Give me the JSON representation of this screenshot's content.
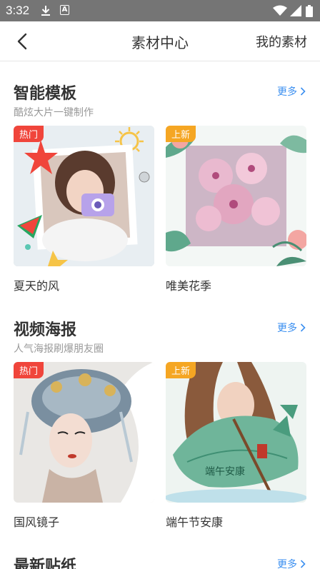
{
  "status_bar": {
    "time": "3:32",
    "a_glyph": "A"
  },
  "header": {
    "title": "素材中心",
    "right_link": "我的素材"
  },
  "sections": [
    {
      "title": "智能模板",
      "subtitle": "酷炫大片一键制作",
      "more": "更多",
      "items": [
        {
          "badge": "热门",
          "label": "夏天的风"
        },
        {
          "badge": "上新",
          "label": "唯美花季"
        }
      ]
    },
    {
      "title": "视频海报",
      "subtitle": "人气海报刷爆朋友圈",
      "more": "更多",
      "items": [
        {
          "badge": "热门",
          "label": "国风镜子"
        },
        {
          "badge": "上新",
          "label": "端午节安康"
        }
      ]
    },
    {
      "title": "最新贴纸",
      "more": "更多"
    }
  ],
  "colors": {
    "accent": "#3b8ff0",
    "hot": "#f0453b",
    "new": "#f5a623",
    "statusbar": "#757575"
  },
  "icons": [
    "download-icon",
    "a-icon",
    "wifi-icon",
    "cell-signal-icon",
    "battery-icon",
    "back-arrow-icon",
    "chevron-right-icon"
  ]
}
